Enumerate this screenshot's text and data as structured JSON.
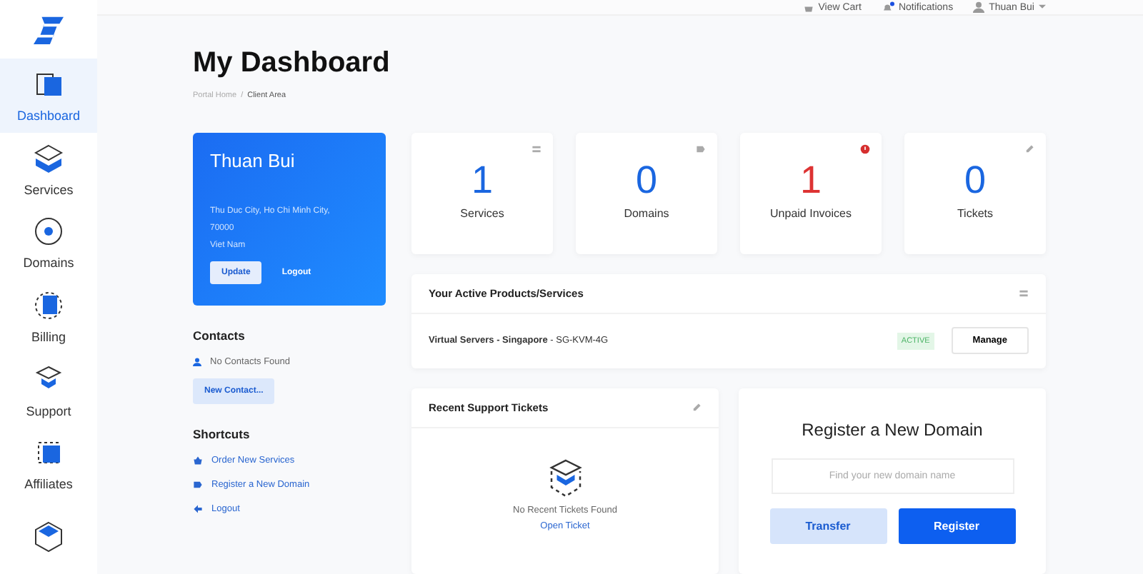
{
  "sidebar": {
    "items": [
      {
        "label": "Dashboard",
        "kind": "dashboard",
        "selected": true
      },
      {
        "label": "Services",
        "kind": "services",
        "selected": false
      },
      {
        "label": "Domains",
        "kind": "domains",
        "selected": false
      },
      {
        "label": "Billing",
        "kind": "billing",
        "selected": false
      },
      {
        "label": "Support",
        "kind": "support",
        "selected": false
      },
      {
        "label": "Affiliates",
        "kind": "affiliates",
        "selected": false
      },
      {
        "kind": "cube",
        "selected": false
      }
    ]
  },
  "topbar": {
    "cart": "View Cart",
    "notifications": "Notifications",
    "has_unread": true,
    "user": "Thuan Bui"
  },
  "page": {
    "title": "My Dashboard",
    "breadcrumb": [
      "Portal Home",
      "Client Area"
    ],
    "separator": "/"
  },
  "profile": {
    "name": "Thuan Bui",
    "address": [
      "Thu Duc City, Ho Chi Minh City,",
      "70000",
      "Viet Nam"
    ],
    "buttons": [
      "Update",
      "Logout"
    ]
  },
  "contacts": {
    "title": "Contacts",
    "empty": "No Contacts Found",
    "button": "New Contact..."
  },
  "shortcuts": {
    "title": "Shortcuts",
    "items": [
      {
        "label": "Order New Services",
        "kind": "basket"
      },
      {
        "label": "Register a New Domain",
        "kind": "tag"
      },
      {
        "label": "Logout",
        "kind": "back"
      }
    ]
  },
  "stats": [
    {
      "value": "1",
      "label": "Services",
      "kind": "server",
      "alert": false
    },
    {
      "value": "0",
      "label": "Domains",
      "kind": "tag",
      "alert": false
    },
    {
      "value": "1",
      "label": "Unpaid Invoices",
      "alert": true
    },
    {
      "value": "0",
      "label": "Tickets",
      "kind": "comment",
      "alert": false
    }
  ],
  "products": {
    "title": "Your Active Products/Services",
    "rows": [
      {
        "name": "**Virtual Servers - Singapore** - SG-KVM-4G",
        "status": "ACTIVE",
        "action": "Manage"
      }
    ]
  },
  "tickets": {
    "title": "Recent Support Tickets",
    "empty": "No Recent Tickets Found",
    "link": "Open Ticket"
  },
  "domain": {
    "title": "Register a New Domain",
    "placeholder": "Find your new domain name",
    "buttons": [
      "Transfer",
      "Register"
    ]
  }
}
